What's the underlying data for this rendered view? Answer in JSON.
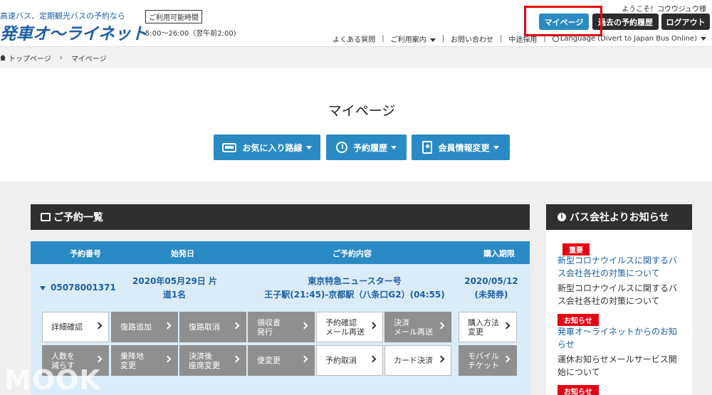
{
  "header": {
    "tagline": "高速バス、定期観光バスの予約なら",
    "logo": "発車オ〜ライネット",
    "hours_label": "ご利用可能時間",
    "hours_value": "5:00〜26:00（翌午前2:00)",
    "welcome": "ようこそ！コウウジュウ様",
    "mypage_btn": "マイページ",
    "history_btn": "過去の予約履歴",
    "logout_btn": "ログアウト",
    "subnav": {
      "faq": "よくある質問",
      "guide": "ご利用案内",
      "contact": "お問い合わせ",
      "recruit": "中途採用",
      "language": "Language (Divert to Japan Bus Online)"
    }
  },
  "breadcrumb": {
    "home": "トップページ",
    "current": "マイページ"
  },
  "page": {
    "title": "マイページ",
    "tabs": {
      "favorites": "お気に入り路線",
      "history": "予約履歴",
      "member": "会員情報変更"
    }
  },
  "reservations": {
    "heading": "ご予約一覧",
    "columns": {
      "number": "予約番号",
      "date": "始発日",
      "content": "ご予約内容",
      "deadline": "購入期限"
    },
    "row": {
      "number": "05078001371",
      "date_line1": "2020年05月29日 片",
      "date_line2": "道1名",
      "bus_name": "東京特急ニュースター号",
      "route": "王子駅(21:45)-京都駅（八条口G2）(04:55)",
      "deadline_date": "2020/05/12",
      "deadline_status": "(未発券)"
    },
    "actions": {
      "detail": "詳細確認",
      "add_return": "復路追加",
      "cancel_return": "復路取消",
      "receipt": "領収書\n発行",
      "resend_confirm": "予約確認\nメール再送",
      "resend_payment": "決済\nメール再送",
      "change_payment": "購入方法\n変更",
      "reduce_people": "人数を\n減らす",
      "change_stop": "乗降地\n変更",
      "change_seat": "決済後\n座席変更",
      "change_bus": "便変更",
      "cancel_res": "予約取消",
      "card_payment": "カード決済",
      "mobile_ticket": "モバイル\nチケット"
    }
  },
  "notices": {
    "heading": "バス会社よりお知らせ",
    "items": [
      {
        "badge": "重要",
        "link": "新型コロナウイルスに関するバス会社各社の対策について",
        "text": "新型コロナウイルスに関するバス会社各社の対策について"
      },
      {
        "badge": "お知らせ",
        "link": "発車オ〜ライネットからのお知らせ",
        "text": "運休お知らせメールサービス開始について"
      },
      {
        "badge": "お知らせ"
      }
    ]
  },
  "watermark": "MOOK",
  "colors": {
    "primary": "#2a8ac4",
    "dark": "#2f2f2f",
    "red": "#e60012",
    "light_blue": "#daecf7"
  }
}
